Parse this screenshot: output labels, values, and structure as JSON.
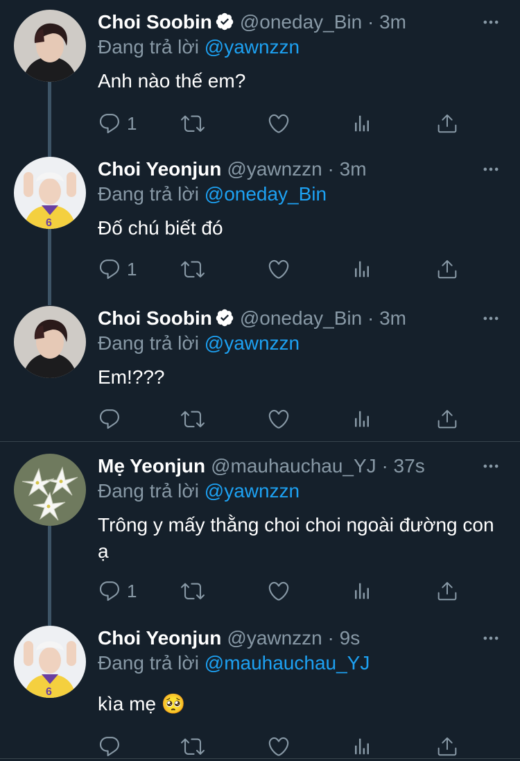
{
  "tweets": [
    {
      "name": "Choi Soobin",
      "verified": true,
      "handle": "@oneday_Bin",
      "sep": "·",
      "time": "3m",
      "reply_prefix": "Đang trả lời",
      "reply_to": "@yawnzzn",
      "text": "Anh nào thế em?",
      "reply_count": "1",
      "avatar": "dark-hair-portrait"
    },
    {
      "name": "Choi Yeonjun",
      "verified": false,
      "handle": "@yawnzzn",
      "sep": "·",
      "time": "3m",
      "reply_prefix": "Đang trả lời",
      "reply_to": "@oneday_Bin",
      "text": "Đố chú biết đó",
      "reply_count": "1",
      "avatar": "yellow-jersey-portrait"
    },
    {
      "name": "Choi Soobin",
      "verified": true,
      "handle": "@oneday_Bin",
      "sep": "·",
      "time": "3m",
      "reply_prefix": "Đang trả lời",
      "reply_to": "@yawnzzn",
      "text": "Em!???",
      "reply_count": "",
      "avatar": "dark-hair-portrait"
    },
    {
      "name": "Mẹ Yeonjun",
      "verified": false,
      "handle": "@mauhauchau_YJ",
      "sep": "·",
      "time": "37s",
      "reply_prefix": "Đang trả lời",
      "reply_to": "@yawnzzn",
      "text": "Trông y mấy thằng choi choi ngoài đường con ạ",
      "reply_count": "1",
      "avatar": "white-lilies"
    },
    {
      "name": "Choi Yeonjun",
      "verified": false,
      "handle": "@yawnzzn",
      "sep": "·",
      "time": "9s",
      "reply_prefix": "Đang trả lời",
      "reply_to": "@mauhauchau_YJ",
      "text": "kìa mẹ 🥺",
      "reply_count": "",
      "avatar": "yellow-jersey-portrait"
    }
  ],
  "colors": {
    "background": "#15202b",
    "secondary_text": "#8899a6",
    "link": "#1da1f2",
    "thread_line": "#3d5466"
  },
  "icons": {
    "reply": "comment-icon",
    "retweet": "retweet-icon",
    "like": "heart-icon",
    "analytics": "analytics-icon",
    "share": "share-icon",
    "more": "more-icon",
    "verified": "verified-badge-icon"
  }
}
